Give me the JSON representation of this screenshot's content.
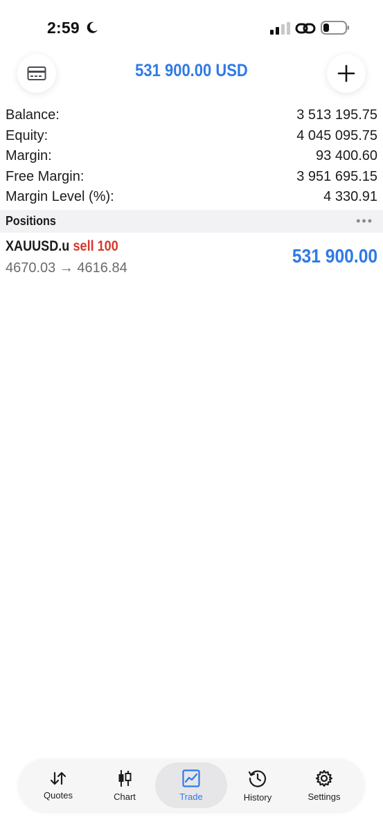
{
  "status_bar": {
    "time": "2:59",
    "icons": [
      "moon-icon",
      "cellular-signal-icon",
      "link-icon",
      "battery-icon"
    ]
  },
  "header": {
    "title": "531 900.00 USD",
    "left_button_icon": "card-icon",
    "right_button_icon": "plus-icon"
  },
  "summary": {
    "rows": [
      {
        "label": "Balance:",
        "value": "3 513 195.75"
      },
      {
        "label": "Equity:",
        "value": "4 045 095.75"
      },
      {
        "label": "Margin:",
        "value": "93 400.60"
      },
      {
        "label": "Free Margin:",
        "value": "3 951 695.15"
      },
      {
        "label": "Margin Level (%):",
        "value": "4 330.91"
      }
    ]
  },
  "positions": {
    "title": "Positions",
    "more_icon": "more-dots-icon",
    "items": [
      {
        "symbol": "XAUUSD.u",
        "side": "sell 100",
        "prices": "4670.03 → 4616.84",
        "profit": "531 900.00"
      }
    ]
  },
  "tabbar": {
    "tabs": [
      {
        "label": "Quotes",
        "icon": "quotes-arrows-icon"
      },
      {
        "label": "Chart",
        "icon": "candlestick-icon"
      },
      {
        "label": "Trade",
        "icon": "trade-chart-icon",
        "active": true
      },
      {
        "label": "History",
        "icon": "history-clock-icon"
      },
      {
        "label": "Settings",
        "icon": "gear-icon"
      }
    ]
  },
  "colors": {
    "accent": "#2f7ae5",
    "sell": "#d6392c",
    "section_bg": "#f2f2f4"
  }
}
